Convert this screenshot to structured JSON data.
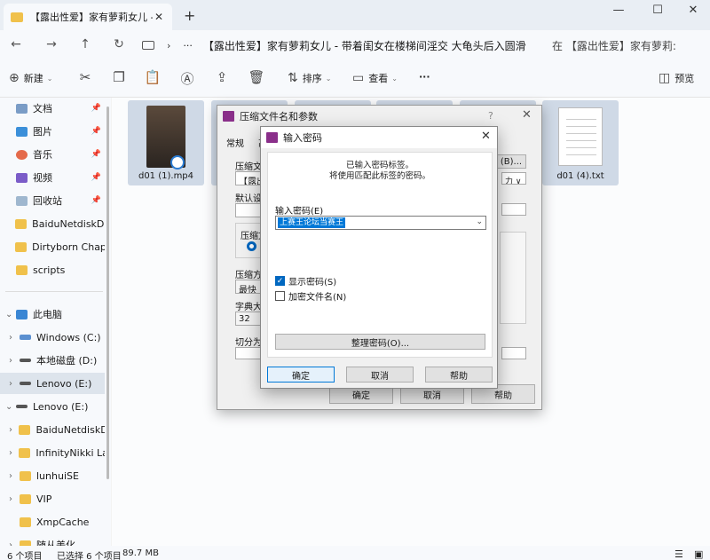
{
  "window": {
    "tab_title": "【露出性爱】家有萝莉女儿 - 带",
    "tab_close": "✕",
    "new_tab": "+",
    "minimize": "—",
    "maximize": "☐",
    "close": "✕"
  },
  "nav": {
    "back": "←",
    "forward": "→",
    "up": "↑",
    "refresh": "↻",
    "chevron": "›",
    "more": "···",
    "path": "【露出性爱】家有萝莉女儿 - 带着闺女在楼梯间淫交 大龟头后入圆滑",
    "search_placeholder": "在 【露出性爱】家有萝莉:"
  },
  "toolbar": {
    "new": "新建",
    "sort": "排序",
    "view": "查看",
    "more": "···",
    "preview": "预览"
  },
  "sidebar": {
    "items": [
      {
        "label": "文档",
        "icon": "document-icon",
        "pinned": true
      },
      {
        "label": "图片",
        "icon": "picture-icon",
        "pinned": true
      },
      {
        "label": "音乐",
        "icon": "music-icon",
        "pinned": true
      },
      {
        "label": "视频",
        "icon": "video-icon",
        "pinned": true
      },
      {
        "label": "回收站",
        "icon": "recycle-bin-icon",
        "pinned": true
      },
      {
        "label": "BaiduNetdiskDo",
        "icon": "folder-icon"
      },
      {
        "label": "Dirtyborn Chapt",
        "icon": "folder-icon"
      },
      {
        "label": "scripts",
        "icon": "folder-icon"
      },
      {
        "label": "此电脑",
        "icon": "pc-icon"
      },
      {
        "label": "Windows (C:)",
        "icon": "drive-icon"
      },
      {
        "label": "本地磁盘 (D:)",
        "icon": "drive-icon"
      },
      {
        "label": "Lenovo (E:)",
        "icon": "drive-icon"
      },
      {
        "label": "Lenovo (E:)",
        "icon": "drive-icon"
      },
      {
        "label": "BaiduNetdiskD",
        "icon": "folder-icon"
      },
      {
        "label": "InfinityNikki La",
        "icon": "folder-icon"
      },
      {
        "label": "lunhuiSE",
        "icon": "folder-icon"
      },
      {
        "label": "VIP",
        "icon": "folder-icon"
      },
      {
        "label": "XmpCache",
        "icon": "folder-icon"
      },
      {
        "label": "随从美化",
        "icon": "folder-icon"
      }
    ]
  },
  "files": [
    {
      "name": "d01 (1).mp4"
    },
    {
      "name": "d01 (4).txt"
    }
  ],
  "status": {
    "count": "6 个项目",
    "selected": "已选择 6 个项目",
    "size": "89.7 MB"
  },
  "archive_dialog": {
    "title": "压缩文件名和参数",
    "help": "?",
    "tab_general": "常规",
    "tab_other": "高",
    "archive_label": "压缩文件",
    "archive_value": "【露出",
    "browse": "(B)...",
    "default_label": "默认设",
    "format_label": "压缩文",
    "method_label": "压缩方",
    "method_value": "最快",
    "dict_label": "字典大小",
    "dict_value": "32",
    "split_label": "切分为",
    "update_value": "力 ∨",
    "ok": "确定",
    "cancel": "取消",
    "help_btn": "帮助"
  },
  "password_dialog": {
    "title": "输入密码",
    "hint_line1": "已输入密码标签。",
    "hint_line2": "将使用匹配此标签的密码。",
    "password_label": "输入密码(E)",
    "password_value": "上赛王论坛当赛王",
    "show_password": "显示密码(S)",
    "encrypt_names": "加密文件名(N)",
    "organize": "整理密码(O)...",
    "ok": "确定",
    "cancel": "取消",
    "help": "帮助"
  }
}
